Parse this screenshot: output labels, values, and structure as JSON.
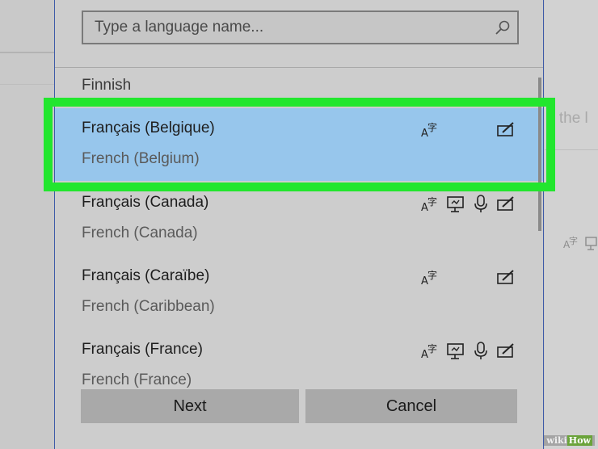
{
  "search": {
    "placeholder": "Type a language name..."
  },
  "languages": [
    {
      "native": "Finnish",
      "english": ""
    },
    {
      "native": "Français (Belgique)",
      "english": "French (Belgium)",
      "selected": true,
      "features": [
        "display-language",
        "handwriting"
      ]
    },
    {
      "native": "Français (Canada)",
      "english": "French (Canada)",
      "features": [
        "display-language",
        "text-to-speech",
        "speech-recognition",
        "handwriting"
      ]
    },
    {
      "native": "Français (Caraïbe)",
      "english": "French (Caribbean)",
      "features": [
        "display-language",
        "handwriting"
      ]
    },
    {
      "native": "Français (France)",
      "english": "French (France)",
      "features": [
        "display-language",
        "text-to-speech",
        "speech-recognition",
        "handwriting"
      ]
    }
  ],
  "buttons": {
    "next": "Next",
    "cancel": "Cancel"
  },
  "background": {
    "right_text": "n the l"
  },
  "watermark": {
    "prefix": "wiki",
    "brand": "How"
  },
  "colors": {
    "selected": "#97c6ec",
    "highlight": "#22e62e",
    "dialog_border": "#3d5aa8"
  }
}
